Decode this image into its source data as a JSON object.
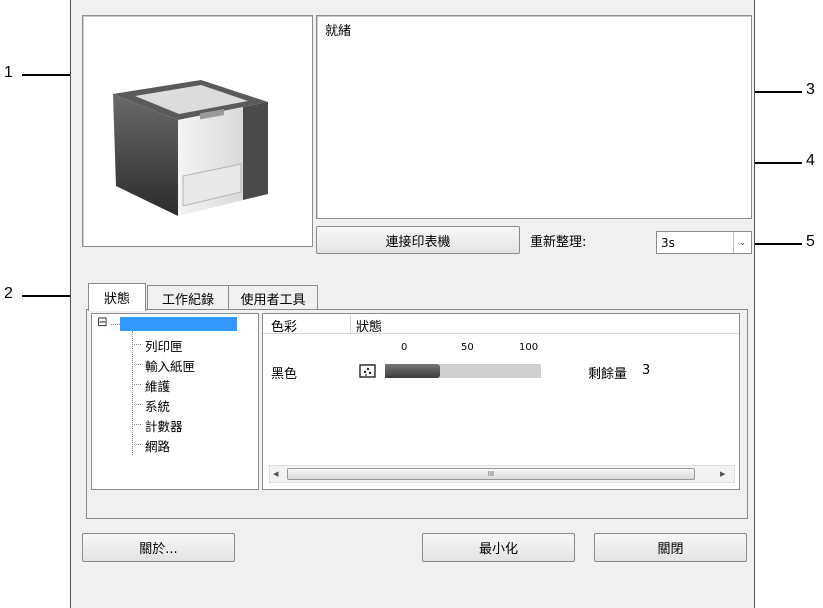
{
  "callouts": [
    "1",
    "2",
    "3",
    "4",
    "5"
  ],
  "status_text": "就緒",
  "connect_button": "連接印表機",
  "refresh": {
    "label": "重新整理:",
    "value": "3s"
  },
  "tabs": [
    "狀態",
    "工作紀錄",
    "使用者工具"
  ],
  "tree": {
    "expand_symbol": "⊟",
    "items": [
      "列印匣",
      "輸入紙匣",
      "維護",
      "系統",
      "計數器",
      "網路"
    ]
  },
  "table": {
    "headers": [
      "色彩",
      "狀態"
    ],
    "scale_labels": [
      "0",
      "50",
      "100"
    ],
    "rows": [
      {
        "color": "黑色",
        "level_percent": 35,
        "remaining_label": "剩餘量",
        "remaining_value": "3"
      }
    ]
  },
  "scrollbar": {
    "left_arrow": "◂",
    "right_arrow": "▸",
    "grip": "III"
  },
  "buttons": {
    "about": "關於...",
    "minimize": "最小化",
    "close": "關閉"
  },
  "colors": {
    "window_bg": "#f0f0f0",
    "selection": "#3399ff",
    "toner_fill": "#555555",
    "toner_track": "#cfcfcf"
  }
}
